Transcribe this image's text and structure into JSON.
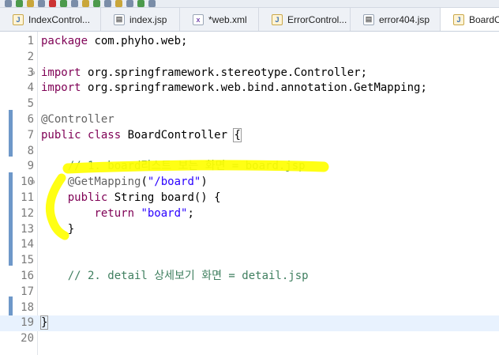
{
  "tabs": [
    {
      "label": "IndexControl...",
      "icon": "java-file-icon",
      "active": false
    },
    {
      "label": "index.jsp",
      "icon": "jsp-file-icon",
      "active": false
    },
    {
      "label": "*web.xml",
      "icon": "xml-file-icon",
      "active": false
    },
    {
      "label": "ErrorControl...",
      "icon": "java-file-icon",
      "active": false
    },
    {
      "label": "error404.jsp",
      "icon": "jsp-file-icon",
      "active": false
    },
    {
      "label": "BoardCo",
      "icon": "java-file-icon",
      "active": true
    }
  ],
  "editor": {
    "current_line": 19,
    "lines": [
      {
        "n": "1",
        "segs": [
          [
            "kw",
            "package"
          ],
          [
            "p",
            " com.phyho.web;"
          ]
        ]
      },
      {
        "n": "2",
        "segs": []
      },
      {
        "n": "3",
        "fold": "⊖",
        "segs": [
          [
            "kw",
            "import"
          ],
          [
            "p",
            " org.springframework.stereotype.Controller;"
          ]
        ]
      },
      {
        "n": "4",
        "segs": [
          [
            "kw",
            "import"
          ],
          [
            "p",
            " org.springframework.web.bind.annotation.GetMapping;"
          ]
        ]
      },
      {
        "n": "5",
        "segs": []
      },
      {
        "n": "6",
        "segs": [
          [
            "an",
            "@Controller"
          ]
        ]
      },
      {
        "n": "7",
        "segs": [
          [
            "kw",
            "public"
          ],
          [
            "p",
            " "
          ],
          [
            "kw",
            "class"
          ],
          [
            "p",
            " BoardController "
          ],
          [
            "bracket",
            "{"
          ]
        ]
      },
      {
        "n": "8",
        "segs": []
      },
      {
        "n": "9",
        "segs": [
          [
            "p",
            "    "
          ],
          [
            "cm",
            "// 1. board리스트 보는 화면 = board.jsp"
          ]
        ]
      },
      {
        "n": "10",
        "fold": "⊖",
        "segs": [
          [
            "p",
            "    "
          ],
          [
            "an",
            "@GetMapping"
          ],
          [
            "p",
            "("
          ],
          [
            "st",
            "\"/board\""
          ],
          [
            "p",
            ")"
          ]
        ]
      },
      {
        "n": "11",
        "segs": [
          [
            "p",
            "    "
          ],
          [
            "kw",
            "public"
          ],
          [
            "p",
            " String board() {"
          ]
        ]
      },
      {
        "n": "12",
        "segs": [
          [
            "p",
            "        "
          ],
          [
            "kw",
            "return"
          ],
          [
            "p",
            " "
          ],
          [
            "st",
            "\"board\""
          ],
          [
            "p",
            ";"
          ]
        ]
      },
      {
        "n": "13",
        "segs": [
          [
            "p",
            "    }"
          ]
        ]
      },
      {
        "n": "14",
        "segs": []
      },
      {
        "n": "15",
        "segs": []
      },
      {
        "n": "16",
        "segs": [
          [
            "p",
            "    "
          ],
          [
            "cm",
            "// 2. detail 상세보기 화면 = detail.jsp"
          ]
        ]
      },
      {
        "n": "17",
        "segs": []
      },
      {
        "n": "18",
        "segs": []
      },
      {
        "n": "19",
        "segs": [
          [
            "bracket",
            "}"
          ]
        ]
      },
      {
        "n": "20",
        "segs": []
      }
    ]
  },
  "colors": {
    "keyword": "#7f0055",
    "comment": "#3f7f5f",
    "annotation": "#646464",
    "string": "#2a00ff",
    "highlighter": "#ffff00",
    "change_marker": "#6e98c9"
  }
}
